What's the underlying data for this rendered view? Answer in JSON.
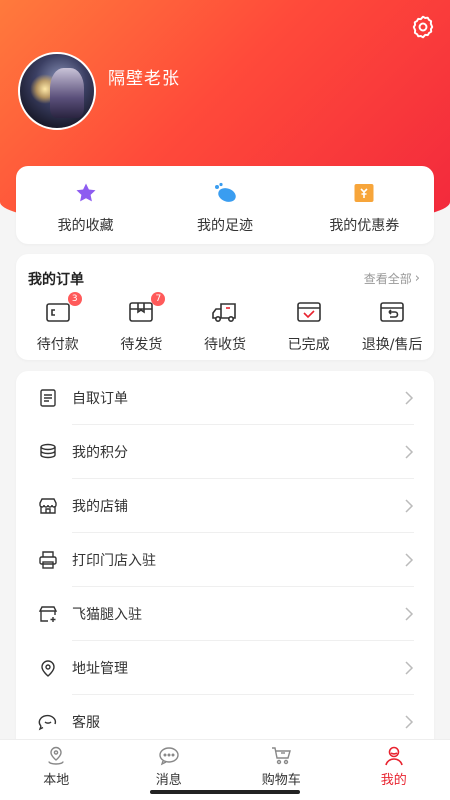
{
  "profile": {
    "username": "隔壁老张"
  },
  "quick_links": [
    {
      "label": "我的收藏",
      "icon": "star-icon"
    },
    {
      "label": "我的足迹",
      "icon": "footprint-icon"
    },
    {
      "label": "我的优惠券",
      "icon": "coupon-icon"
    }
  ],
  "orders": {
    "title": "我的订单",
    "view_all": "查看全部",
    "items": [
      {
        "label": "待付款",
        "badge": "3",
        "icon": "wallet-icon"
      },
      {
        "label": "待发货",
        "badge": "7",
        "icon": "package-icon"
      },
      {
        "label": "待收货",
        "badge": "",
        "icon": "truck-icon"
      },
      {
        "label": "已完成",
        "badge": "",
        "icon": "check-box-icon"
      },
      {
        "label": "退换/售后",
        "badge": "",
        "icon": "return-icon"
      }
    ]
  },
  "menu": [
    {
      "label": "自取订单",
      "icon": "document-icon"
    },
    {
      "label": "我的积分",
      "icon": "coins-icon"
    },
    {
      "label": "我的店铺",
      "icon": "store-icon"
    },
    {
      "label": "打印门店入驻",
      "icon": "printer-icon"
    },
    {
      "label": "飞猫腿入驻",
      "icon": "shop-add-icon"
    },
    {
      "label": "地址管理",
      "icon": "location-icon"
    },
    {
      "label": "客服",
      "icon": "chat-icon"
    }
  ],
  "tabbar": [
    {
      "label": "本地",
      "icon": "local-icon",
      "active": false
    },
    {
      "label": "消息",
      "icon": "message-icon",
      "active": false
    },
    {
      "label": "购物车",
      "icon": "cart-icon",
      "active": false
    },
    {
      "label": "我的",
      "icon": "user-icon",
      "active": true
    }
  ],
  "colors": {
    "accent": "#e8232f",
    "header_start": "#ff7a3c",
    "header_end": "#f2283c"
  }
}
